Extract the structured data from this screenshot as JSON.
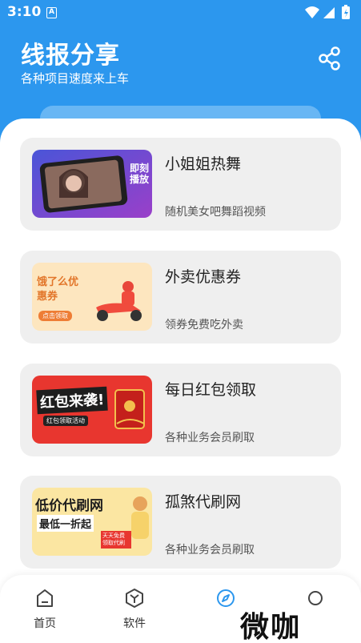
{
  "status": {
    "time": "3:10",
    "badge": "A"
  },
  "header": {
    "title": "线报分享",
    "subtitle": "各种项目速度来上车",
    "share_icon": "share-icon",
    "colors": {
      "primary": "#2c97ee",
      "card_bg": "#efefef"
    }
  },
  "cards": [
    {
      "name": "小姐姐热舞",
      "desc": "随机美女吧舞蹈视频",
      "thumb_text": "即刻播放"
    },
    {
      "name": "外卖优惠券",
      "desc": "领券免费吃外卖",
      "thumb_text": "饿了么优惠券",
      "thumb_sub": "点击领取"
    },
    {
      "name": "每日红包领取",
      "desc": "各种业务会员刷取",
      "thumb_text": "红包来袭!",
      "thumb_sub": "红包领取活动"
    },
    {
      "name": "孤煞代刷网",
      "desc": "各种业务会员刷取",
      "thumb_text": "低价代刷网",
      "thumb_line2": "最低一折起",
      "thumb_sub": "天天免费领取代刷"
    }
  ],
  "nav": [
    {
      "label": "首页",
      "icon": "home-icon"
    },
    {
      "label": "软件",
      "icon": "box-icon"
    },
    {
      "label": "",
      "icon": "compass-icon",
      "active": true
    },
    {
      "label": "",
      "icon": "circle-icon"
    }
  ],
  "watermark": "微咖"
}
